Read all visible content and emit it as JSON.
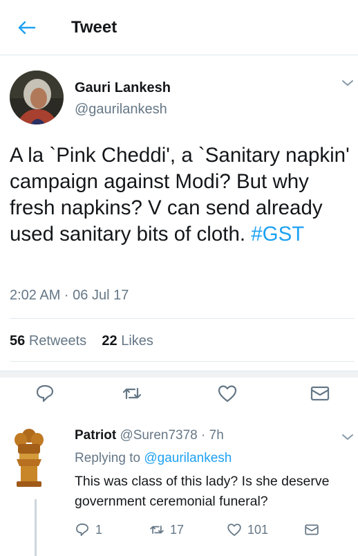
{
  "header": {
    "title": "Tweet",
    "back_icon": "back-arrow-icon"
  },
  "tweet": {
    "author_name": "Gauri Lankesh",
    "author_handle": "@gaurilankesh",
    "text": "A la `Pink Cheddi', a `Sanitary napkin' campaign against Modi? But why fresh napkins? V can send already used sanitary bits of cloth. ",
    "hashtag": "#GST",
    "timestamp": "2:02 AM · 06 Jul 17",
    "retweets_count": "56",
    "retweets_label": "Retweets",
    "likes_count": "22",
    "likes_label": "Likes"
  },
  "reply": {
    "author_name": "Patriot",
    "author_handle": "@Suren7378",
    "time": "· 7h",
    "replying_prefix": "Replying to",
    "replying_to": "@gaurilankesh",
    "text": "This was class of this lady? Is she deserve government ceremonial funeral?",
    "reply_count": "1",
    "retweet_count": "17",
    "like_count": "101"
  },
  "colors": {
    "accent": "#1da1f2",
    "muted": "#657786",
    "text": "#14171a",
    "divider": "#e1e8ed"
  }
}
